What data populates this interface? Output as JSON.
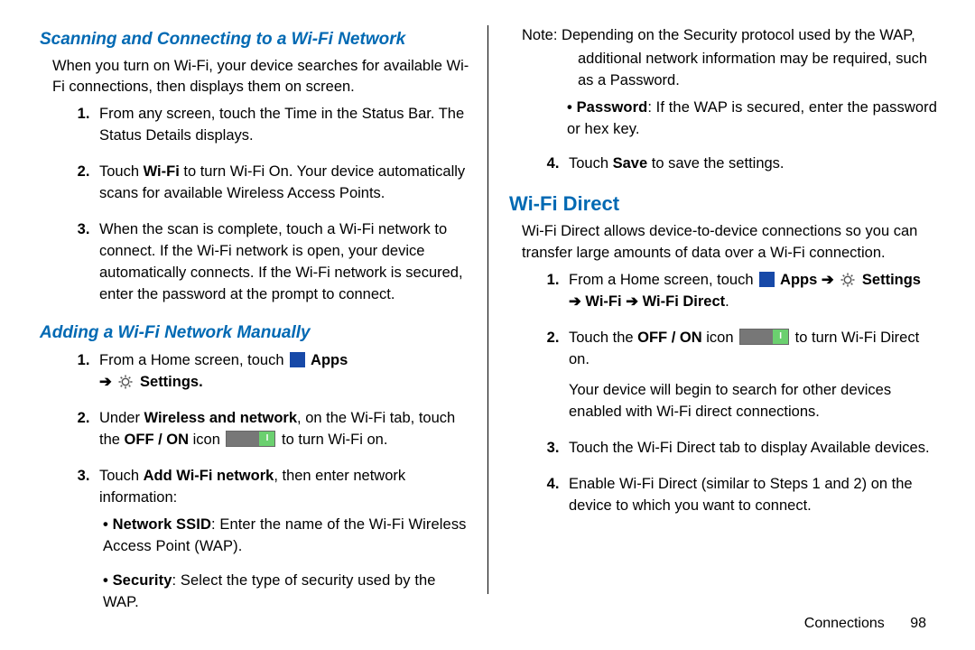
{
  "colors": {
    "accent": "#0069b3"
  },
  "left": {
    "subhead1": "Scanning and Connecting to a Wi-Fi Network",
    "intro1": "When you turn on Wi-Fi, your device searches for available Wi-Fi connections, then displays them on screen.",
    "step1a": "From any screen, touch the Time in the Status Bar. The Status Details displays.",
    "step2aPre": "Touch ",
    "step2aBold": "Wi-Fi",
    "step2aPost": " to turn Wi-Fi On. Your device automatically scans for available Wireless Access Points.",
    "step3a": "When the scan is complete, touch a Wi-Fi network to connect. If the Wi-Fi network is open, your device automatically connects. If the Wi-Fi network is secured, enter the password at the prompt to connect.",
    "subhead2": "Adding a Wi-Fi Network Manually",
    "step1bPre": "From a Home screen, touch ",
    "appsLabel": "  Apps",
    "arrow": " ➔ ",
    "settingsLabel": "  Settings.",
    "step2bPre": "Under ",
    "step2bBold1": "Wireless and network",
    "step2bMid": ", on the Wi-Fi tab, touch the ",
    "step2bBold2": "OFF / ON",
    "step2bMid2": " icon ",
    "step2bPost": " to turn Wi-Fi on.",
    "step3bPre": "Touch ",
    "step3bBold": "Add Wi-Fi network",
    "step3bPost": ", then enter network information:",
    "bullet1Bold": "Network SSID",
    "bullet1": ": Enter the name of the Wi-Fi Wireless Access Point (WAP).",
    "bullet2Bold": "Security",
    "bullet2": ": Select the type of security used by the WAP."
  },
  "right": {
    "noteBold": "Note:",
    "noteLine1": " Depending on the Security protocol used by the WAP,",
    "noteLine2": "additional network information may be required, such as a Password.",
    "bullet3Bold": "Password",
    "bullet3": ": If the WAP is secured, enter the password or hex key.",
    "step4Pre": "Touch ",
    "step4Bold": "Save",
    "step4Post": " to save the settings.",
    "sechead": "Wi-Fi Direct",
    "intro2": "Wi-Fi Direct allows device-to-device connections so you can transfer large amounts of data over a Wi-Fi connection.",
    "d1Pre": "From a Home screen, touch ",
    "d1Apps": "  Apps",
    "d1Arrow1": " ➔ ",
    "d1Settings": "  Settings",
    "d1Arrow2": " ➔ ",
    "d1Wifi": "Wi-Fi ",
    "d1Arrow3": " ➔ ",
    "d1WD": " Wi-Fi Direct",
    "d1Dot": ".",
    "d2Pre": "Touch the ",
    "d2Bold": "OFF / ON",
    "d2Mid": " icon ",
    "d2Post": " to turn Wi-Fi Direct on.",
    "d2Para": "Your device will begin to search for other devices enabled with Wi-Fi direct connections.",
    "d3": "Touch the Wi-Fi Direct tab to display Available devices.",
    "d4": "Enable Wi-Fi Direct (similar to Steps 1 and 2) on the device to which you want to connect."
  },
  "footer": {
    "section": "Connections",
    "page": "98"
  }
}
